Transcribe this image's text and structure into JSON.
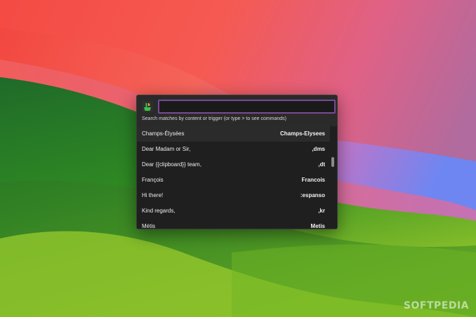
{
  "search": {
    "placeholder": "",
    "value": "",
    "hint": "Search matches by content or trigger (or type > to see commands)"
  },
  "app": {
    "icon": "espanso-icon"
  },
  "results": [
    {
      "label": "Champs-Élysées",
      "trigger": "Champs-Elysees"
    },
    {
      "label": "Dear Madam or Sir,",
      "trigger": ",dms"
    },
    {
      "label": "Dear {{clipboard}} team,",
      "trigger": ",dt"
    },
    {
      "label": "François",
      "trigger": "Francois"
    },
    {
      "label": "Hi there!",
      "trigger": ":espanso"
    },
    {
      "label": "Kind regards,",
      "trigger": ",kr"
    },
    {
      "label": "Métis",
      "trigger": "Metis"
    }
  ],
  "watermark": "SOFTPEDIA",
  "colors": {
    "accent_border": "#7a4a95",
    "panel_bg": "#1f1f1f"
  }
}
